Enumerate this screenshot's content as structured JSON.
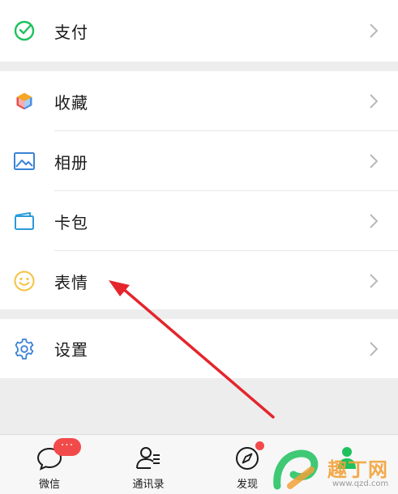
{
  "menu": {
    "pay_label": "支付",
    "favorites_label": "收藏",
    "album_label": "相册",
    "cards_label": "卡包",
    "stickers_label": "表情",
    "settings_label": "设置"
  },
  "tabbar": {
    "chats_label": "微信",
    "chats_badge": "···",
    "contacts_label": "通讯录",
    "discover_label": "发现"
  },
  "watermark": {
    "text": "趣丁网",
    "url": "www.qzd.com"
  },
  "colors": {
    "pay_icon": "#1ec15e",
    "album_icon": "#3b82d6",
    "cards_icon": "#2a9bd8",
    "stickers_icon": "#f3c444",
    "settings_icon": "#3b82d6",
    "badge": "#f24a4a",
    "arrow": "#e4252c"
  }
}
